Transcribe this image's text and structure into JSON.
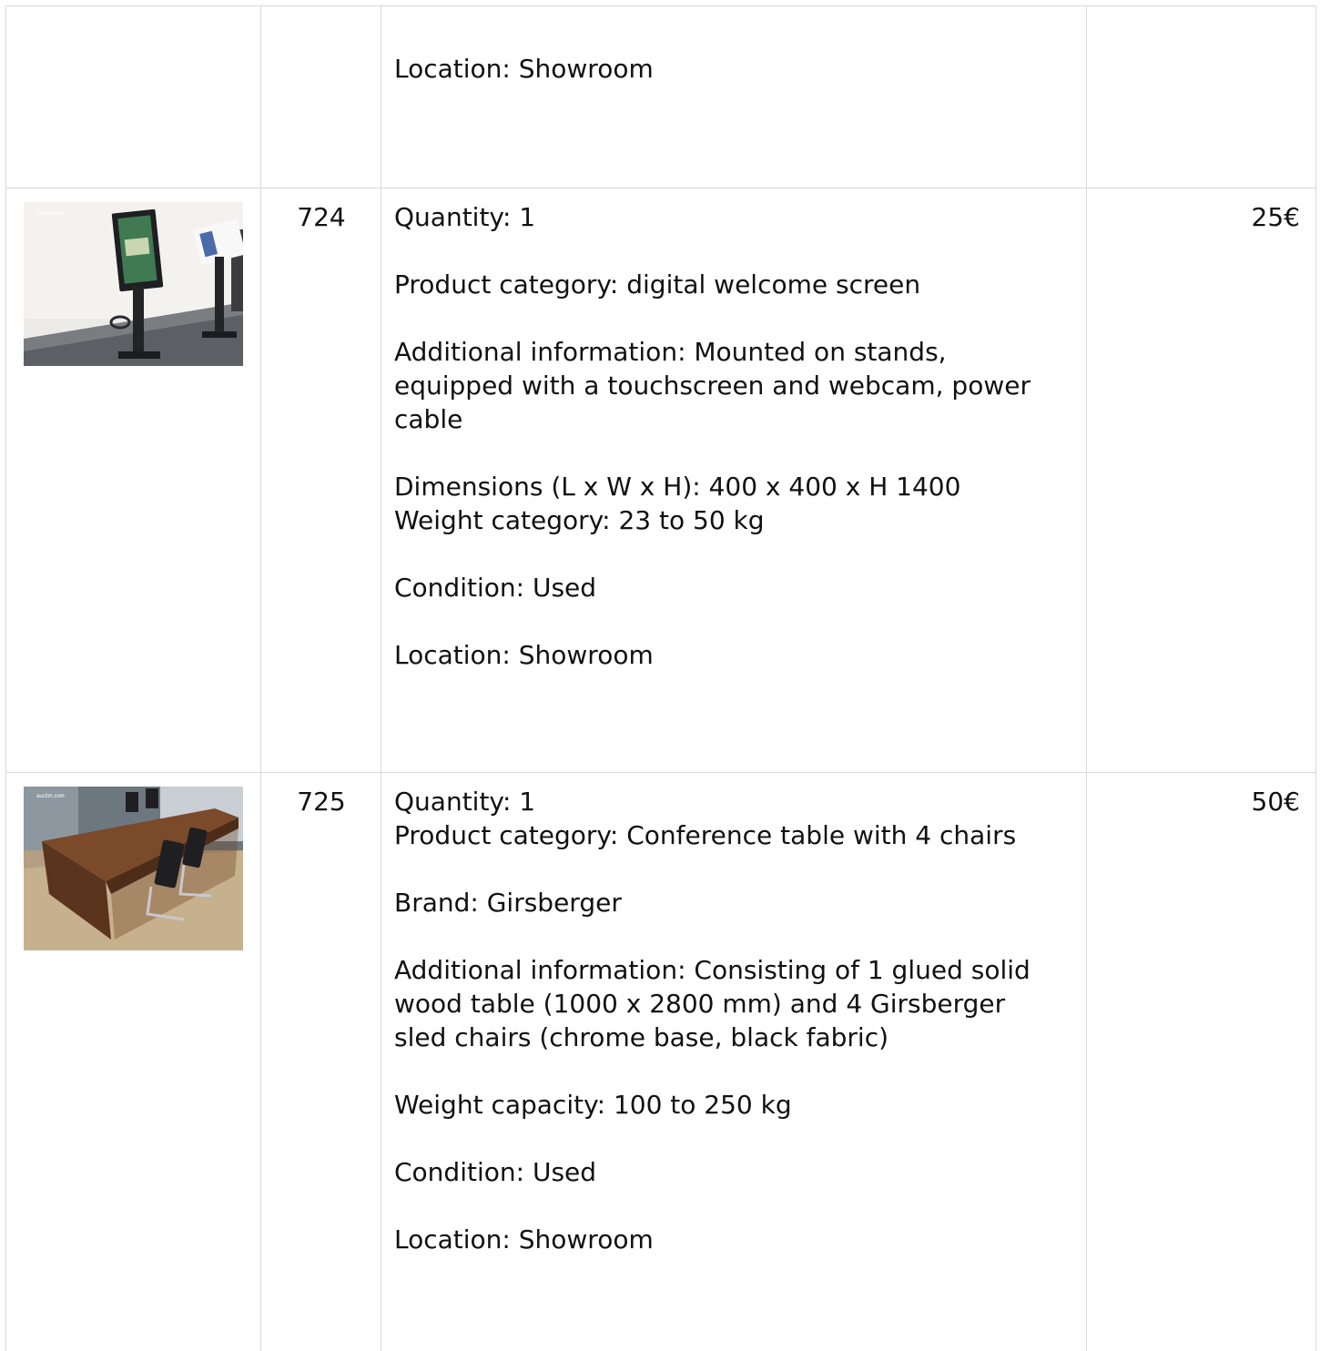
{
  "rows": [
    {
      "lot": "",
      "price": "",
      "lines": [
        "Location: Showroom"
      ]
    },
    {
      "lot": "724",
      "price": "25€",
      "image_alt": "Digital welcome screen kiosk on stand",
      "watermark": "auctim.com",
      "lines": [
        "Quantity: 1",
        "Product category: digital welcome screen",
        "Additional information: Mounted on stands,\nequipped with a touchscreen and webcam, power\ncable",
        "Dimensions (L x W x H): 400 x 400 x H 1400\nWeight category: 23 to 50 kg",
        "Condition: Used",
        "Location: Showroom"
      ]
    },
    {
      "lot": "725",
      "price": "50€",
      "image_alt": "Wooden conference table with chairs",
      "watermark": "auctim.com",
      "lines": [
        "Quantity: 1\nProduct category: Conference table with 4 chairs",
        "Brand: Girsberger",
        "Additional information: Consisting of 1 glued solid\nwood table (1000 x 2800 mm) and 4 Girsberger\nsled chairs (chrome base, black fabric)",
        "Weight capacity: 100 to 250 kg",
        "Condition: Used",
        "Location: Showroom"
      ]
    }
  ]
}
